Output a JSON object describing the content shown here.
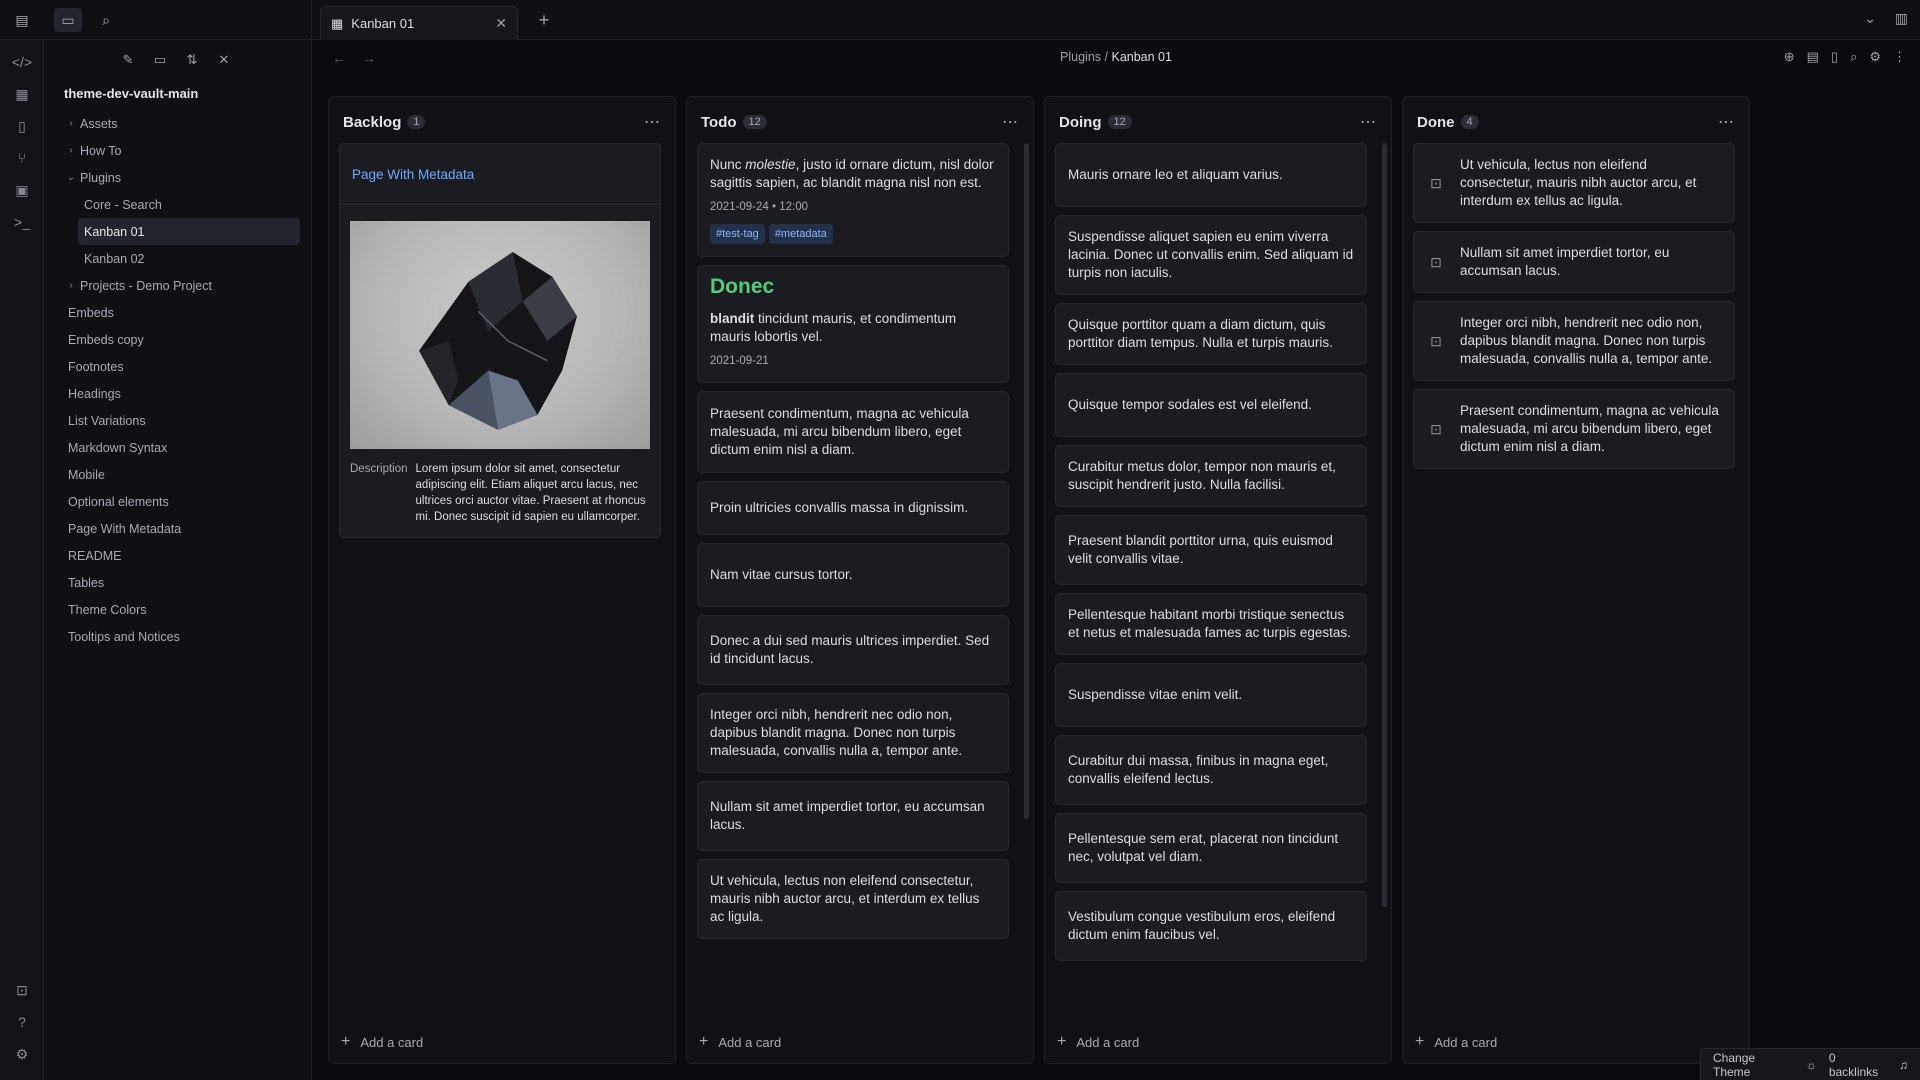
{
  "tab": {
    "title": "Kanban 01"
  },
  "breadcrumb": {
    "parent": "Plugins",
    "separator": "/",
    "current": "Kanban 01"
  },
  "sidebar": {
    "vault": "theme-dev-vault-main",
    "items": [
      {
        "label": "Assets",
        "type": "folder"
      },
      {
        "label": "How To",
        "type": "folder"
      },
      {
        "label": "Plugins",
        "type": "folder-open"
      },
      {
        "label": "Core - Search",
        "type": "child"
      },
      {
        "label": "Kanban 01",
        "type": "child-selected"
      },
      {
        "label": "Kanban 02",
        "type": "child"
      },
      {
        "label": "Projects - Demo Project",
        "type": "folder"
      },
      {
        "label": "Embeds",
        "type": "file"
      },
      {
        "label": "Embeds copy",
        "type": "file"
      },
      {
        "label": "Footnotes",
        "type": "file"
      },
      {
        "label": "Headings",
        "type": "file"
      },
      {
        "label": "List Variations",
        "type": "file"
      },
      {
        "label": "Markdown Syntax",
        "type": "file"
      },
      {
        "label": "Mobile",
        "type": "file"
      },
      {
        "label": "Optional elements",
        "type": "file"
      },
      {
        "label": "Page With Metadata",
        "type": "file"
      },
      {
        "label": "README",
        "type": "file"
      },
      {
        "label": "Tables",
        "type": "file"
      },
      {
        "label": "Theme Colors",
        "type": "file"
      },
      {
        "label": "Tooltips and Notices",
        "type": "file"
      }
    ]
  },
  "lanes": {
    "backlog": {
      "title": "Backlog",
      "count": "1",
      "card": {
        "link": "Page With Metadata",
        "desc_key": "Description",
        "desc_val": "Lorem ipsum dolor sit amet, consectetur adipiscing elit. Etiam aliquet arcu lacus, nec ultrices orci auctor vitae. Praesent at rhoncus mi. Donec suscipit id sapien eu ullamcorper."
      }
    },
    "todo": {
      "title": "Todo",
      "count": "12",
      "card1": {
        "pre": "Nunc ",
        "em": "molestie",
        "post": ", justo id ornare dictum, nisl dolor sagittis sapien, ac blandit magna nisl non est.",
        "meta": "2021-09-24 • 12:00",
        "tag1": "#test-tag",
        "tag2": "#metadata"
      },
      "card2": {
        "heading": "Donec",
        "bold": "blandit",
        "text": " tincidunt mauris, et condimentum mauris lobortis vel.",
        "meta": "2021-09-21"
      },
      "cards": [
        "Praesent condimentum, magna ac vehicula malesuada, mi arcu bibendum libero, eget dictum enim nisl a diam.",
        "Proin ultricies convallis massa in dignissim.",
        "Nam vitae cursus tortor.",
        "Donec a dui sed mauris ultrices imperdiet. Sed id tincidunt lacus.",
        "Integer orci nibh, hendrerit nec odio non, dapibus blandit magna. Donec non turpis malesuada, convallis nulla a, tempor ante.",
        "Nullam sit amet imperdiet tortor, eu accumsan lacus.",
        "Ut vehicula, lectus non eleifend consectetur, mauris nibh auctor arcu, et interdum ex tellus ac ligula."
      ]
    },
    "doing": {
      "title": "Doing",
      "count": "12",
      "cards": [
        "Mauris ornare leo et aliquam varius.",
        "Suspendisse aliquet sapien eu enim viverra lacinia. Donec ut convallis enim. Sed aliquam id turpis non iaculis.",
        "Quisque porttitor quam a diam dictum, quis porttitor diam tempus. Nulla et turpis mauris.",
        "Quisque tempor sodales est vel eleifend.",
        "Curabitur metus dolor, tempor non mauris et, suscipit hendrerit justo. Nulla facilisi.",
        "Praesent blandit porttitor urna, quis euismod velit convallis vitae.",
        "Pellentesque habitant morbi tristique senectus et netus et malesuada fames ac turpis egestas.",
        "Suspendisse vitae enim velit.",
        "Curabitur dui massa, finibus in magna eget, convallis eleifend lectus.",
        "Pellentesque sem erat, placerat non tincidunt nec, volutpat vel diam.",
        "Vestibulum congue vestibulum eros, eleifend dictum enim faucibus vel."
      ]
    },
    "done": {
      "title": "Done",
      "count": "4",
      "cards": [
        "Ut vehicula, lectus non eleifend consectetur, mauris nibh auctor arcu, et interdum ex tellus ac ligula.",
        "Nullam sit amet imperdiet tortor, eu accumsan lacus.",
        "Integer orci nibh, hendrerit nec odio non, dapibus blandit magna. Donec non turpis malesuada, convallis nulla a, tempor ante.",
        "Praesent condimentum, magna ac vehicula malesuada, mi arcu bibendum libero, eget dictum enim nisl a diam."
      ]
    },
    "add_card": "Add a card"
  },
  "statusbar": {
    "theme": "Change Theme",
    "backlinks": "0 backlinks"
  },
  "colors": {
    "accent": "#6ea8ff",
    "heading_green": "#4ed07a",
    "background": "#0a0b0e"
  }
}
